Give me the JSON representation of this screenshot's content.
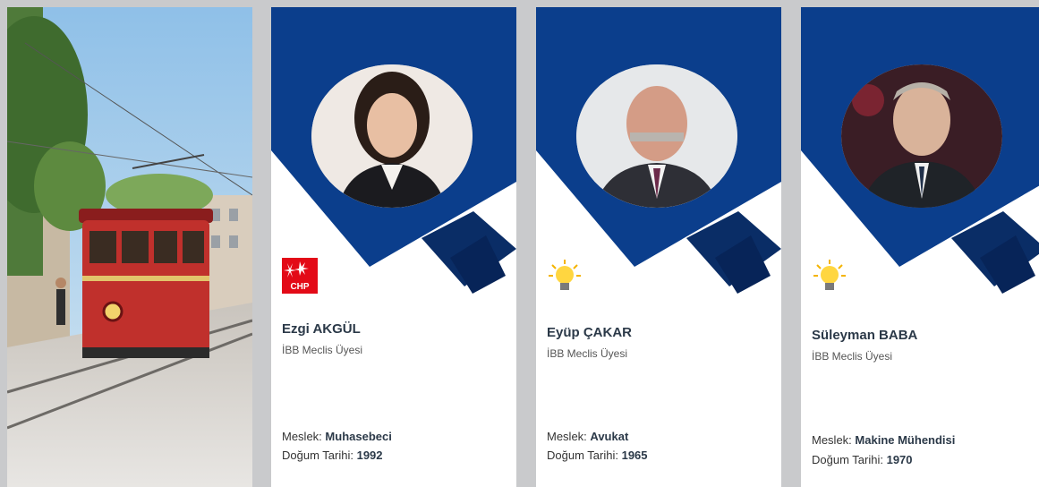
{
  "colors": {
    "banner": "#0b3e8c",
    "banner_dark": "#0a2d66",
    "page_bg": "#c9cacc"
  },
  "photo": {
    "subject": "Istanbul tram on Istiklal street"
  },
  "members": [
    {
      "name": "Ezgi AKGÜL",
      "role": "İBB Meclis Üyesi",
      "profession_label": "Meslek:",
      "profession": "Muhasebeci",
      "birth_label": "Doğum Tarihi:",
      "birth_year": "1992",
      "party_logo_text": "CHP",
      "party_icon": "chp-logo-icon"
    },
    {
      "name": "Eyüp ÇAKAR",
      "role": "İBB Meclis Üyesi",
      "profession_label": "Meslek:",
      "profession": "Avukat",
      "birth_label": "Doğum Tarihi:",
      "birth_year": "1965",
      "party_icon": "akp-bulb-icon"
    },
    {
      "name": "Süleyman BABA",
      "role": "İBB Meclis Üyesi",
      "profession_label": "Meslek:",
      "profession": "Makine Mühendisi",
      "birth_label": "Doğum Tarihi:",
      "birth_year": "1970",
      "party_icon": "akp-bulb-icon"
    }
  ]
}
